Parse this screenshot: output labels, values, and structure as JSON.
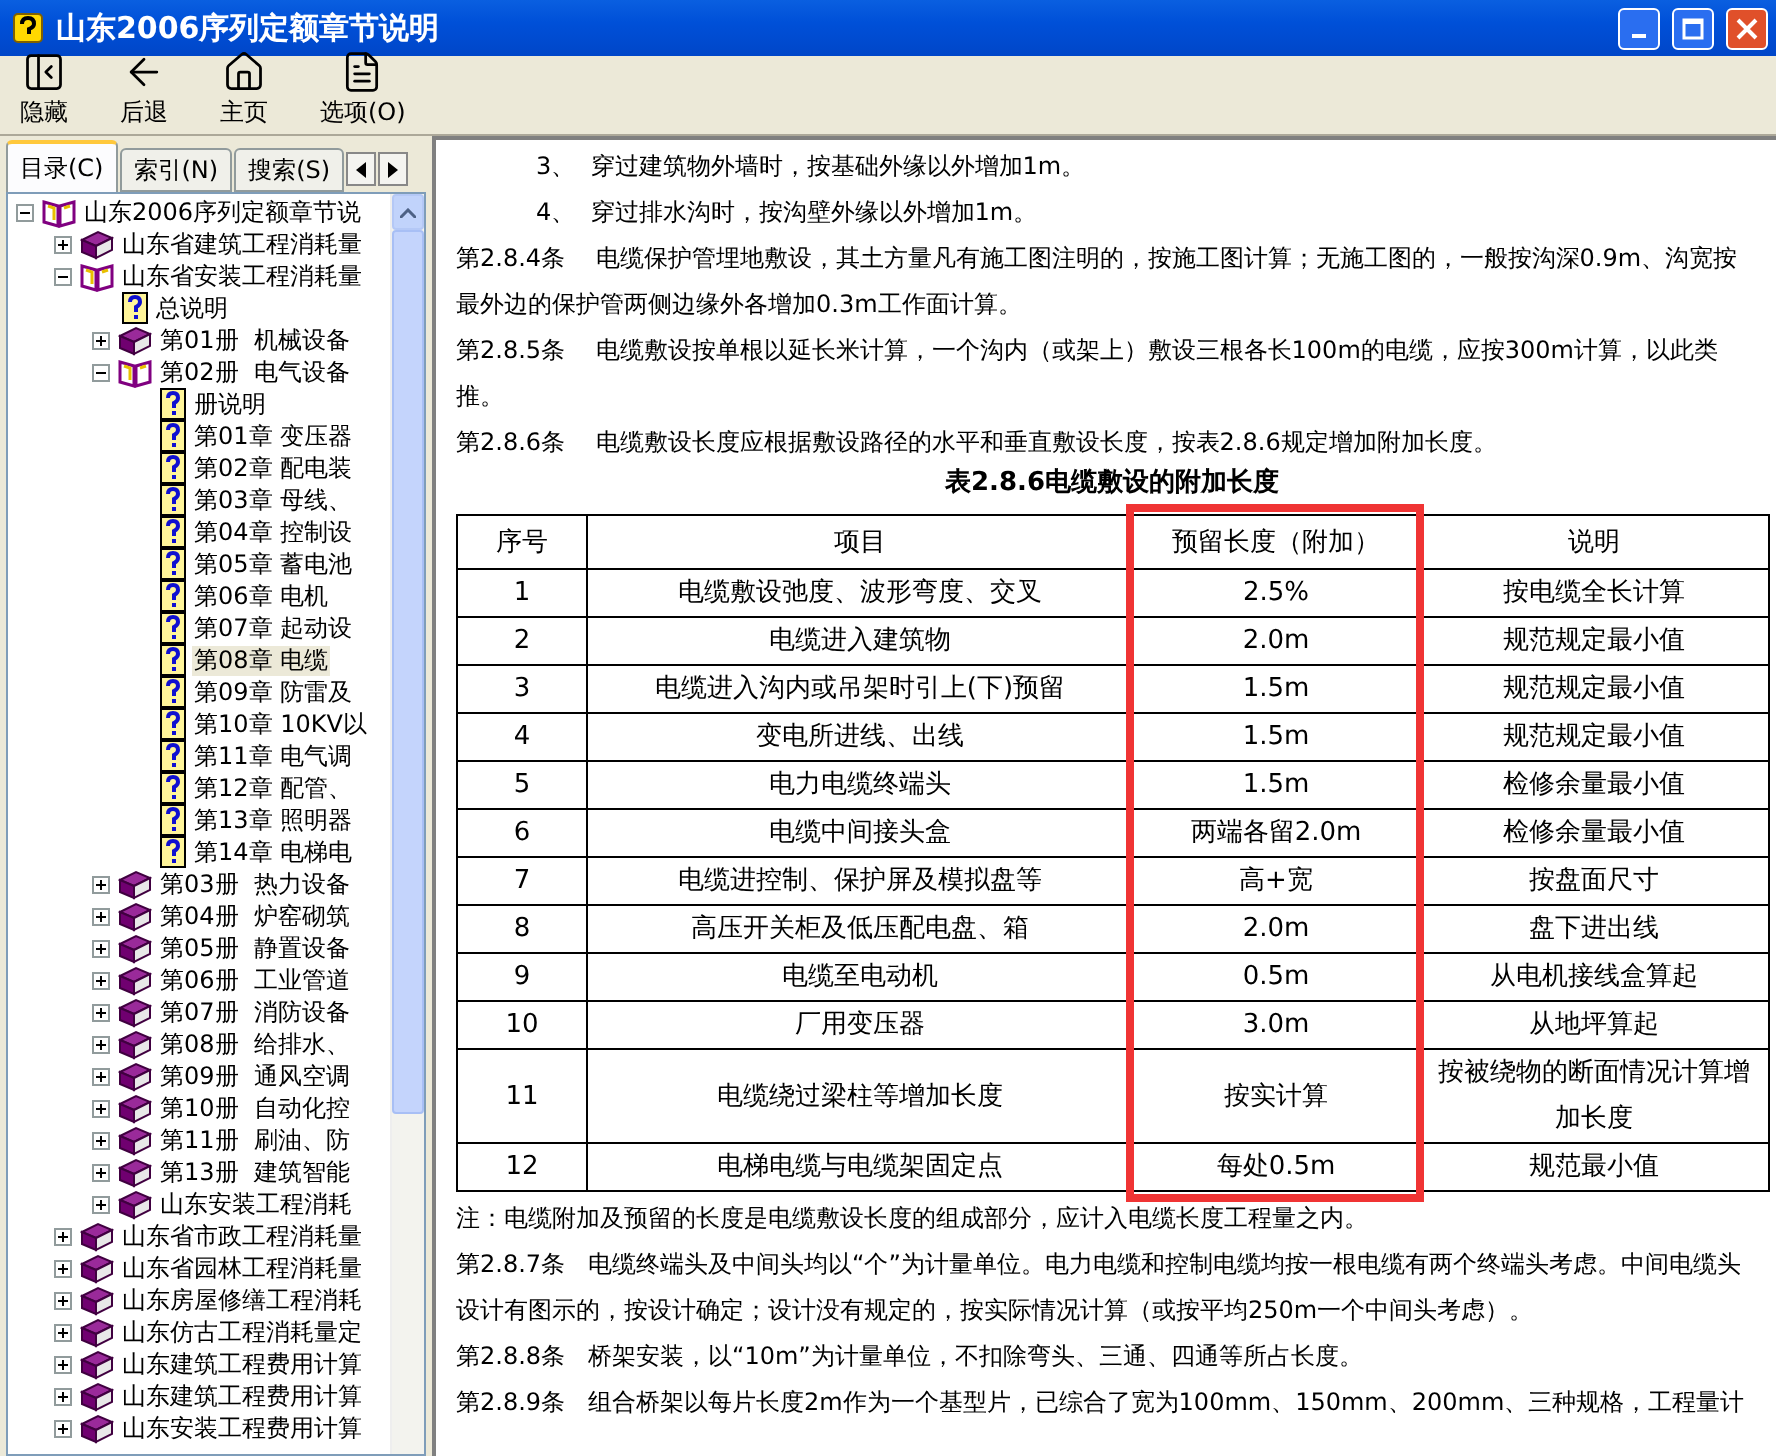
{
  "window": {
    "title": "山东2006序列定额章节说明"
  },
  "toolbar": [
    {
      "label": "隐藏",
      "kind": "hide"
    },
    {
      "label": "后退",
      "kind": "back"
    },
    {
      "label": "主页",
      "kind": "home"
    },
    {
      "label": "选项(O)",
      "kind": "options"
    }
  ],
  "nav_tabs": [
    {
      "label": "目录(C)",
      "selected": true
    },
    {
      "label": "索引(N)",
      "selected": false
    },
    {
      "label": "搜索(S)",
      "selected": false
    }
  ],
  "tree": [
    {
      "label": "山东2006序列定额章节说",
      "kind": "book",
      "expanded": true,
      "selected": false,
      "children": [
        {
          "label": "山东省建筑工程消耗量",
          "kind": "book",
          "expanded": false,
          "selected": false
        },
        {
          "label": "山东省安装工程消耗量",
          "kind": "book",
          "expanded": true,
          "selected": false,
          "children": [
            {
              "label": "总说明",
              "kind": "page",
              "selected": false
            },
            {
              "label": "第01册  机械设备",
              "kind": "book",
              "expanded": false,
              "selected": false
            },
            {
              "label": "第02册  电气设备",
              "kind": "book",
              "expanded": true,
              "selected": false,
              "children": [
                {
                  "label": "册说明",
                  "kind": "page",
                  "selected": false
                },
                {
                  "label": "第01章 变压器",
                  "kind": "page",
                  "selected": false
                },
                {
                  "label": "第02章 配电装",
                  "kind": "page",
                  "selected": false
                },
                {
                  "label": "第03章 母线、",
                  "kind": "page",
                  "selected": false
                },
                {
                  "label": "第04章 控制设",
                  "kind": "page",
                  "selected": false
                },
                {
                  "label": "第05章 蓄电池",
                  "kind": "page",
                  "selected": false
                },
                {
                  "label": "第06章 电机",
                  "kind": "page",
                  "selected": false
                },
                {
                  "label": "第07章 起动设",
                  "kind": "page",
                  "selected": false
                },
                {
                  "label": "第08章 电缆",
                  "kind": "page",
                  "selected": true
                },
                {
                  "label": "第09章 防雷及",
                  "kind": "page",
                  "selected": false
                },
                {
                  "label": "第10章 10KV以",
                  "kind": "page",
                  "selected": false
                },
                {
                  "label": "第11章 电气调",
                  "kind": "page",
                  "selected": false
                },
                {
                  "label": "第12章 配管、",
                  "kind": "page",
                  "selected": false
                },
                {
                  "label": "第13章 照明器",
                  "kind": "page",
                  "selected": false
                },
                {
                  "label": "第14章 电梯电",
                  "kind": "page",
                  "selected": false
                }
              ]
            },
            {
              "label": "第03册  热力设备",
              "kind": "book",
              "expanded": false,
              "selected": false
            },
            {
              "label": "第04册  炉窑砌筑",
              "kind": "book",
              "expanded": false,
              "selected": false
            },
            {
              "label": "第05册  静置设备",
              "kind": "book",
              "expanded": false,
              "selected": false
            },
            {
              "label": "第06册  工业管道",
              "kind": "book",
              "expanded": false,
              "selected": false
            },
            {
              "label": "第07册  消防设备",
              "kind": "book",
              "expanded": false,
              "selected": false
            },
            {
              "label": "第08册  给排水、",
              "kind": "book",
              "expanded": false,
              "selected": false
            },
            {
              "label": "第09册  通风空调",
              "kind": "book",
              "expanded": false,
              "selected": false
            },
            {
              "label": "第10册  自动化控",
              "kind": "book",
              "expanded": false,
              "selected": false
            },
            {
              "label": "第11册  刷油、防",
              "kind": "book",
              "expanded": false,
              "selected": false
            },
            {
              "label": "第13册  建筑智能",
              "kind": "book",
              "expanded": false,
              "selected": false
            },
            {
              "label": "山东安装工程消耗",
              "kind": "book",
              "expanded": false,
              "selected": false
            }
          ]
        },
        {
          "label": "山东省市政工程消耗量",
          "kind": "book",
          "expanded": false,
          "selected": false
        },
        {
          "label": "山东省园林工程消耗量",
          "kind": "book",
          "expanded": false,
          "selected": false
        },
        {
          "label": "山东房屋修缮工程消耗",
          "kind": "book",
          "expanded": false,
          "selected": false
        },
        {
          "label": "山东仿古工程消耗量定",
          "kind": "book",
          "expanded": false,
          "selected": false
        },
        {
          "label": "山东建筑工程费用计算",
          "kind": "book",
          "expanded": false,
          "selected": false
        },
        {
          "label": "山东建筑工程费用计算",
          "kind": "book",
          "expanded": false,
          "selected": false
        },
        {
          "label": "山东安装工程费用计算",
          "kind": "book",
          "expanded": false,
          "selected": false
        }
      ]
    }
  ],
  "content": {
    "paragraphs_before": [
      {
        "indented": true,
        "text": "3、  穿过建筑物外墙时，按基础外缘以外增加1m。"
      },
      {
        "indented": true,
        "text": "4、  穿过排水沟时，按沟壁外缘以外增加1m。"
      },
      {
        "indented": false,
        "text": "第2.8.4条    电缆保护管埋地敷设，其土方量凡有施工图注明的，按施工图计算；无施工图的，一般按沟深0.9m、沟宽按最外边的保护管两侧边缘外各增加0.3m工作面计算。"
      },
      {
        "indented": false,
        "text": "第2.8.5条    电缆敷设按单根以延长米计算，一个沟内（或架上）敷设三根各长100m的电缆，应按300m计算，以此类推。"
      },
      {
        "indented": false,
        "text": "第2.8.6条    电缆敷设长度应根据敷设路径的水平和垂直敷设长度，按表2.8.6规定增加附加长度。"
      }
    ],
    "table": {
      "caption": "表2.8.6电缆敷设的附加长度",
      "columns": [
        {
          "label": "序号",
          "highlighted": false
        },
        {
          "label": "项目",
          "highlighted": false
        },
        {
          "label": "预留长度（附加）",
          "highlighted": true
        },
        {
          "label": "说明",
          "highlighted": false
        }
      ],
      "rows": [
        [
          "1",
          "电缆敷设弛度、波形弯度、交叉",
          "2.5%",
          "按电缆全长计算"
        ],
        [
          "2",
          "电缆进入建筑物",
          "2.0m",
          "规范规定最小值"
        ],
        [
          "3",
          "电缆进入沟内或吊架时引上(下)预留",
          "1.5m",
          "规范规定最小值"
        ],
        [
          "4",
          "变电所进线、出线",
          "1.5m",
          "规范规定最小值"
        ],
        [
          "5",
          "电力电缆终端头",
          "1.5m",
          "检修余量最小值"
        ],
        [
          "6",
          "电缆中间接头盒",
          "两端各留2.0m",
          "检修余量最小值"
        ],
        [
          "7",
          "电缆进控制、保护屏及模拟盘等",
          "高+宽",
          "按盘面尺寸"
        ],
        [
          "8",
          "高压开关柜及低压配电盘、箱",
          "2.0m",
          "盘下进出线"
        ],
        [
          "9",
          "电缆至电动机",
          "0.5m",
          "从电机接线盒算起"
        ],
        [
          "10",
          "厂用变压器",
          "3.0m",
          "从地坪算起"
        ],
        [
          "11",
          "电缆绕过梁柱等增加长度",
          "按实计算",
          "按被绕物的断面情况计算增加长度"
        ],
        [
          "12",
          "电梯电缆与电缆架固定点",
          "每处0.5m",
          "规范最小值"
        ]
      ]
    },
    "paragraphs_after": [
      {
        "indented": false,
        "text": "注：电缆附加及预留的长度是电缆敷设长度的组成部分，应计入电缆长度工程量之内。"
      },
      {
        "indented": false,
        "text": "第2.8.7条   电缆终端头及中间头均以“个”为计量单位。电力电缆和控制电缆均按一根电缆有两个终端头考虑。中间电缆头设计有图示的，按设计确定；设计没有规定的，按实际情况计算（或按平均250m一个中间头考虑）。"
      },
      {
        "indented": false,
        "text": "第2.8.8条   桥架安装，以“10m”为计量单位，不扣除弯头、三通、四通等所占长度。"
      },
      {
        "indented": false,
        "text": "第2.8.9条   组合桥架以每片长度2m作为一个基型片，已综合了宽为100mm、150mm、200mm、三种规格，工程量计"
      }
    ]
  }
}
